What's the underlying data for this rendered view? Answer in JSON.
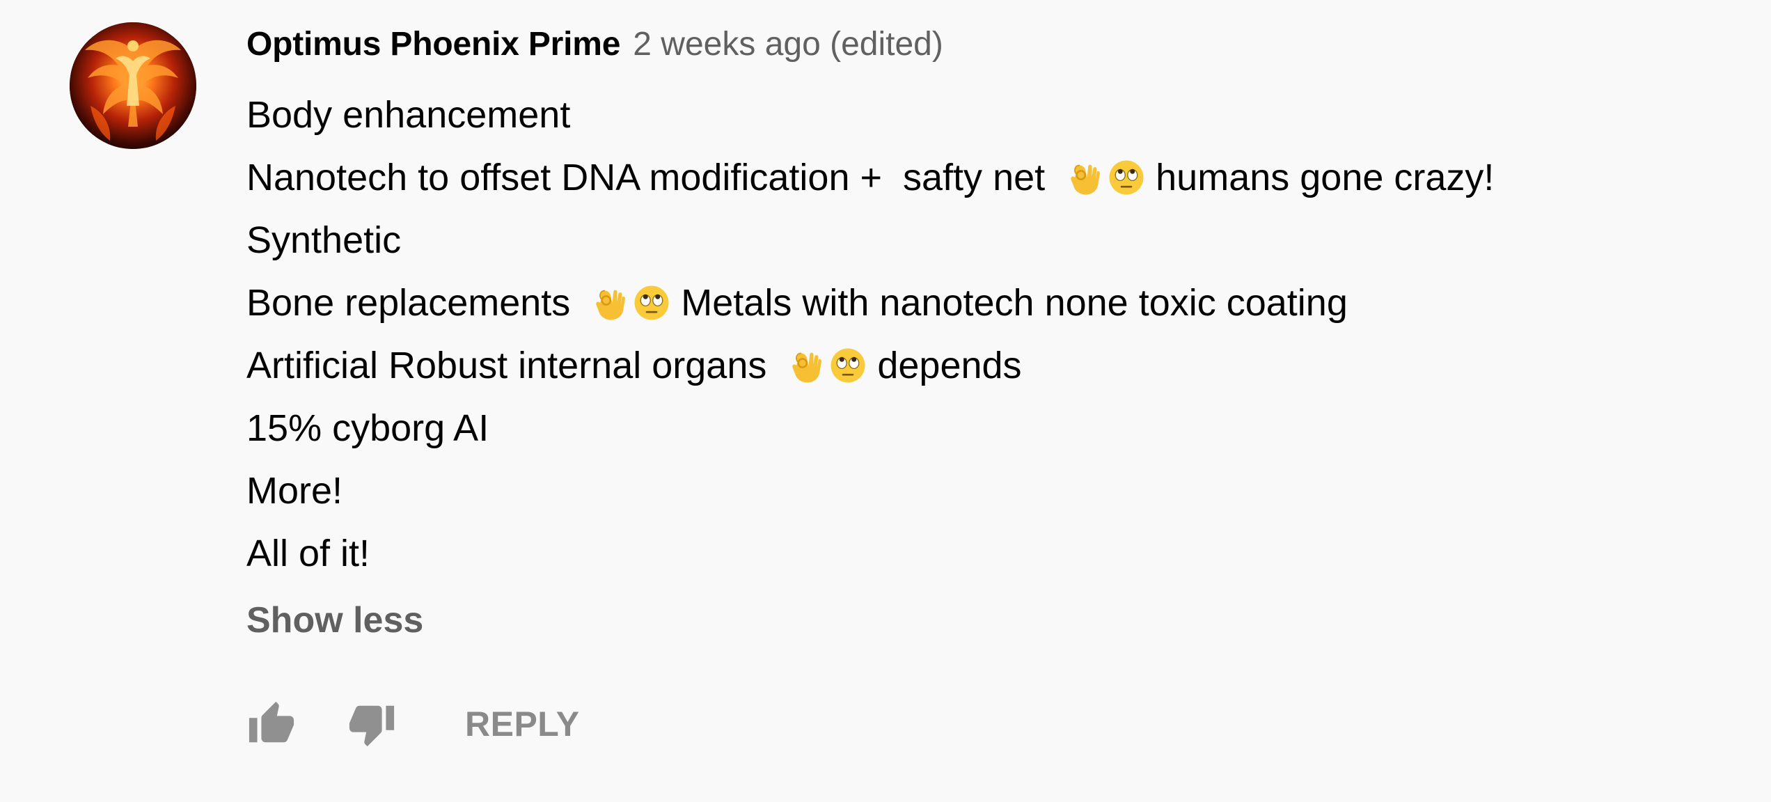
{
  "comment": {
    "author": "Optimus Phoenix Prime",
    "timestamp": "2 weeks ago (edited)",
    "avatar_icon": "phoenix-avatar-icon",
    "lines": [
      {
        "text": "Body enhancement"
      },
      {
        "text": "Nanotech to offset DNA modification +  safty net ",
        "emoji": [
          "ok-hand-emoji",
          "eye-roll-emoji"
        ],
        "after": "humans gone crazy!"
      },
      {
        "text": "Synthetic"
      },
      {
        "text": "Bone replacements ",
        "emoji": [
          "ok-hand-emoji",
          "eye-roll-emoji"
        ],
        "after": "Metals with nanotech none toxic coating"
      },
      {
        "text": "Artificial Robust internal organs ",
        "emoji": [
          "ok-hand-emoji",
          "eye-roll-emoji"
        ],
        "after": "depends"
      },
      {
        "text": "15% cyborg AI"
      },
      {
        "text": "More!"
      },
      {
        "text": "All of it!"
      }
    ],
    "show_less_label": "Show less",
    "actions": {
      "like_icon": "thumbs-up-icon",
      "dislike_icon": "thumbs-down-icon",
      "reply_label": "REPLY"
    }
  },
  "colors": {
    "background": "#f9f9f9",
    "text_primary": "#030303",
    "text_secondary": "#606060",
    "icon_gray": "#909090"
  }
}
